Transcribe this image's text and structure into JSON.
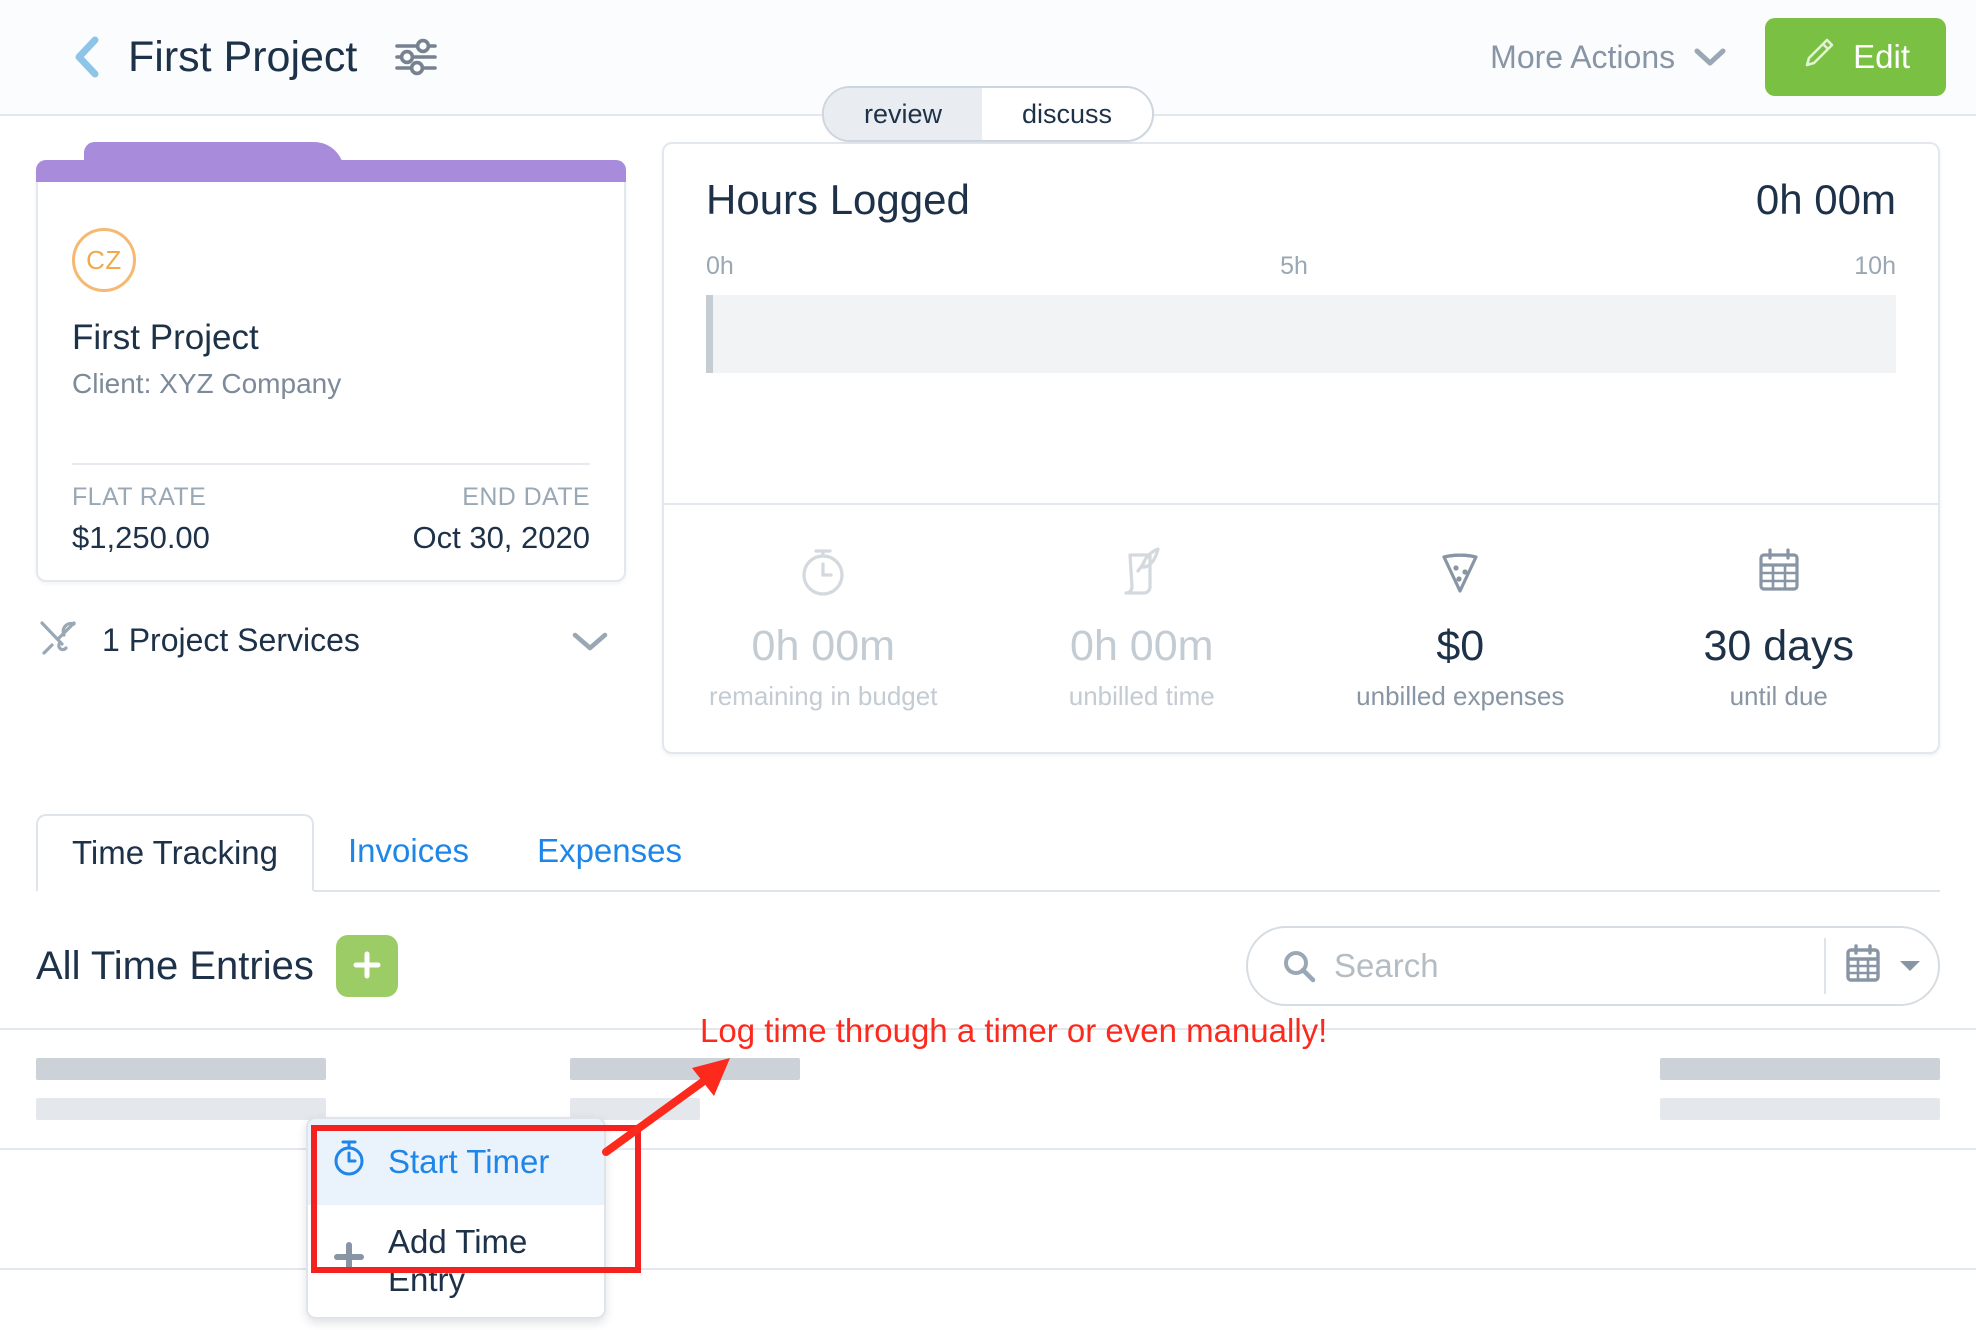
{
  "header": {
    "back_icon": "chevron-left-icon",
    "title": "First Project",
    "settings_icon": "sliders-icon",
    "more_actions_label": "More Actions",
    "more_actions_chevron": "chevron-down-icon",
    "edit_label": "Edit",
    "edit_icon": "pencil-icon",
    "edit_color": "#7ac143"
  },
  "segmented": {
    "options": [
      {
        "label": "review",
        "active": true
      },
      {
        "label": "discuss",
        "active": false
      }
    ]
  },
  "project_card": {
    "tab_color": "#a98bdb",
    "avatar_initials": "CZ",
    "avatar_color": "#f0a94f",
    "name": "First Project",
    "client": "Client: XYZ Company",
    "rate_label": "FLAT RATE",
    "rate_value": "$1,250.00",
    "end_label": "END DATE",
    "end_value": "Oct 30, 2020"
  },
  "services": {
    "icon": "tools-icon",
    "label": "1 Project Services",
    "chevron": "chevron-down-icon"
  },
  "hours_panel": {
    "title": "Hours Logged",
    "total": "0h 00m",
    "axis": [
      "0h",
      "5h",
      "10h"
    ],
    "stats": [
      {
        "icon": "stopwatch-icon",
        "value": "0h 00m",
        "label": "remaining in budget",
        "muted": true
      },
      {
        "icon": "scroll-quill-icon",
        "value": "0h 00m",
        "label": "unbilled time",
        "muted": true
      },
      {
        "icon": "pizza-slice-icon",
        "value": "$0",
        "label": "unbilled expenses",
        "muted": false
      },
      {
        "icon": "calendar-icon",
        "value": "30 days",
        "label": "until due",
        "muted": false
      }
    ]
  },
  "chart_data": {
    "type": "bar",
    "title": "Hours Logged",
    "categories": [
      "Hours Logged"
    ],
    "values": [
      0
    ],
    "value_label": "0h 00m",
    "xlabel": "",
    "ylabel": "",
    "xlim": [
      0,
      10
    ],
    "xticks": [
      0,
      5,
      10
    ],
    "xticklabels": [
      "0h",
      "5h",
      "10h"
    ],
    "grid": false,
    "orientation": "horizontal",
    "bar_color": "#c4ccd4",
    "track_color": "#f1f3f5"
  },
  "tabs": [
    {
      "label": "Time Tracking",
      "active": true
    },
    {
      "label": "Invoices",
      "active": false
    },
    {
      "label": "Expenses",
      "active": false
    }
  ],
  "entries": {
    "title": "All Time Entries",
    "add_icon": "plus-icon",
    "add_color": "#9ccc65"
  },
  "search": {
    "icon": "search-icon",
    "placeholder": "Search",
    "value": "",
    "calendar_icon": "calendar-icon",
    "caret_icon": "caret-down-icon"
  },
  "dropdown": {
    "items": [
      {
        "label": "Start Timer",
        "icon": "stopwatch-icon",
        "highlight": true
      },
      {
        "label": "Add Time Entry",
        "icon": "plus-icon",
        "highlight": false
      }
    ]
  },
  "annotation": {
    "text": "Log time through a timer or even manually!",
    "color": "#fb2a1c"
  }
}
